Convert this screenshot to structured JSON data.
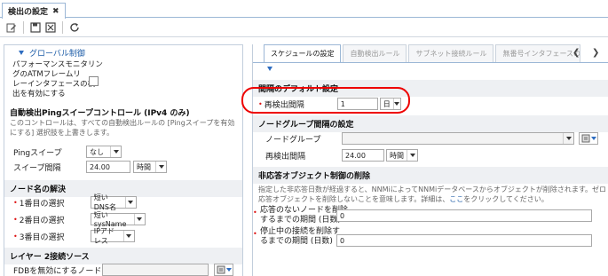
{
  "window": {
    "tab_title": "検出の設定"
  },
  "toolbar": {
    "icons": [
      "edit-icon",
      "save-icon",
      "save-close-icon",
      "refresh-icon"
    ]
  },
  "left": {
    "global_control_label": "グローバル制御",
    "perf_monitor_label_lines": [
      "パフォーマンスモニタリン",
      "グのATMフレームリ",
      "レーインタフェースの検",
      "出を有効にする"
    ],
    "ping_section_title": "自動検出Pingスイープコントロール (IPv4 のみ)",
    "ping_desc": "このコントロールは、すべての自動検出ルールの [Pingスイープを有効にする] 選択肢を上書きします。",
    "ping_sweep_label": "Pingスイープ",
    "ping_sweep_value": "なし",
    "sweep_interval_label": "スイープ間隔",
    "sweep_interval_value": "24.00",
    "sweep_interval_unit": "時間",
    "node_name_title": "ノード名の解決",
    "choice1_label": "1番目の選択",
    "choice1_value": "短いDNS名",
    "choice2_label": "2番目の選択",
    "choice2_value": "短いsysName",
    "choice3_label": "3番目の選択",
    "choice3_value": "IPアドレス",
    "layer2_title": "レイヤー 2接続ソース",
    "fdb_label": "FDBを無効にするノード"
  },
  "right": {
    "tabs": [
      "スケジュールの設定",
      "自動検出ルール",
      "サブネット接続ルール",
      "無番号インタフェースのノ"
    ],
    "interval_title": "間隔のデフォルト設定",
    "rediscovery_label": "再検出間隔",
    "rediscovery_value": "1",
    "rediscovery_unit": "日",
    "node_group_title": "ノードグループ間隔の設定",
    "node_group_label": "ノードグループ",
    "ng_rediscovery_label": "再検出間隔",
    "ng_rediscovery_value": "24.00",
    "ng_rediscovery_unit": "時間",
    "unresponsive_title": "非応答オブジェクト制御の削除",
    "unresponsive_desc_1": "指定した非応答日数が経過すると、NNMiによってNNMiデータベースからオブジェクトが削除されます。ゼロ (0) は、非",
    "unresponsive_desc_2": "応答オブジェクトを削除しないことを意味します。詳細は、",
    "unresponsive_link": "ここ",
    "unresponsive_desc_3": "をクリックしてください。",
    "unresp_node_label_1": "応答のないノードを削除",
    "unresp_node_label_2": "するまでの期間 (日数)",
    "unresp_node_value": "0",
    "stopped_conn_label_1": "停止中の接続を削除す",
    "stopped_conn_label_2": "るまでの期間 (日数)",
    "stopped_conn_value": "0"
  },
  "colors": {
    "accent": "#1f5ea8",
    "highlight": "#e00000",
    "required": "#dd1111"
  }
}
